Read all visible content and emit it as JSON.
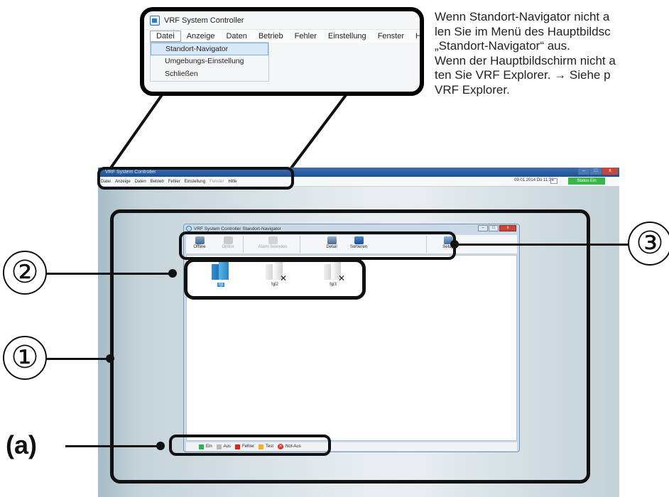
{
  "explanation": {
    "lines": [
      "Wenn Standort-Navigator nicht a",
      "len Sie im Menü des Hauptbildsc",
      "„Standort-Navigator“ aus.",
      "Wenn der Hauptbildschirm nicht a",
      "ten Sie VRF Explorer.  → Siehe p",
      "VRF Explorer."
    ]
  },
  "zoom": {
    "title": "VRF System Controller",
    "menu": [
      "Datei",
      "Anzeige",
      "Daten",
      "Betrieb",
      "Fehler",
      "Einstellung",
      "Fenster",
      "Hilfe"
    ],
    "dropdown": [
      "Standort-Navigator",
      "Umgebungs-Einstellung",
      "Schließen"
    ]
  },
  "app": {
    "title": "VRF System Controller",
    "menu": [
      "Datei",
      "Anzeige",
      "Daten",
      "Betrieb",
      "Fehler",
      "Einstellung",
      "Fenster",
      "Hilfe"
    ],
    "datetime": "09.01.2014 Do 11:34",
    "status": "Status Ein",
    "window_buttons": [
      "–",
      "□",
      "x"
    ]
  },
  "navigator": {
    "title": "VRF System Controller Standort-Navigator",
    "toolbar": {
      "offline": "Offline",
      "online": "Online",
      "alarm": "Alarm beenden",
      "detail": "Detail",
      "sort": "Sortieren",
      "setup": "Setup"
    },
    "sites": [
      {
        "label": "fgl",
        "selected": true,
        "offline": false
      },
      {
        "label": "fgl2",
        "selected": false,
        "offline": true
      },
      {
        "label": "fgl3",
        "selected": false,
        "offline": true
      }
    ],
    "legend": [
      {
        "label": "Ein",
        "color": "#2db34a"
      },
      {
        "label": "Aus",
        "color": "#b8b8b8"
      },
      {
        "label": "Fehler",
        "color": "#e2231a"
      },
      {
        "label": "Test",
        "color": "#f4b223"
      }
    ],
    "legend_stop": "Not-Aus"
  },
  "callouts": {
    "n1": "①",
    "n2": "②",
    "n3": "③",
    "a": "(a)"
  }
}
